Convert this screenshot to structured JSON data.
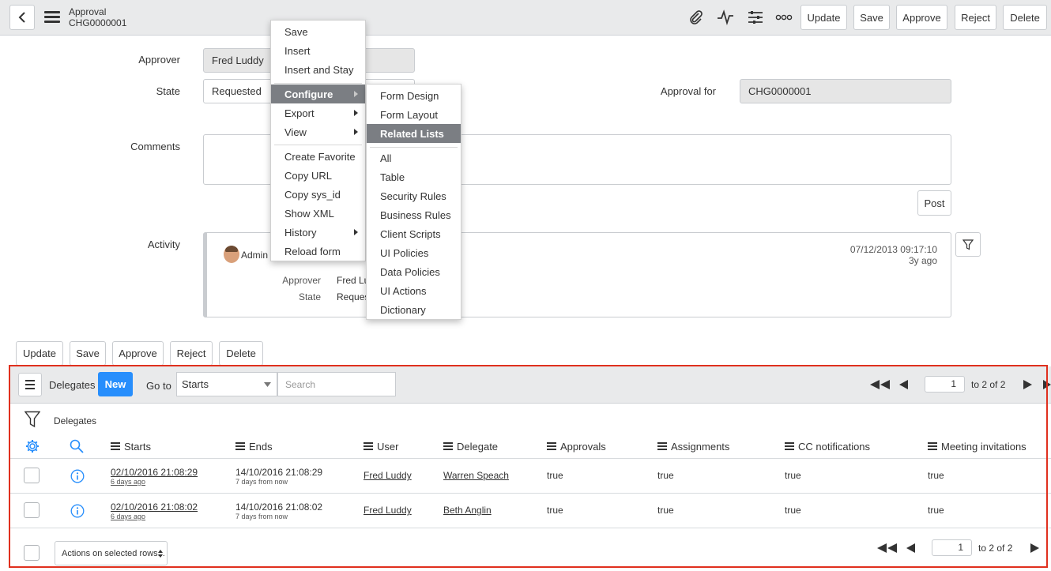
{
  "header": {
    "record_type": "Approval",
    "record_number": "CHG0000001",
    "buttons": [
      "Update",
      "Save",
      "Approve",
      "Reject",
      "Delete"
    ]
  },
  "form": {
    "approver_label": "Approver",
    "approver_value": "Fred Luddy",
    "state_label": "State",
    "state_value": "Requested",
    "approval_for_label": "Approval for",
    "approval_for_value": "CHG0000001",
    "comments_label": "Comments",
    "post_label": "Post",
    "activity_label": "Activity",
    "activity": {
      "user": "Admin",
      "timestamp": "07/12/2013 09:17:10",
      "relative": "3y ago",
      "f1_label": "Approver",
      "f1_value": "Fred Lu",
      "f2_label": "State",
      "f2_value": "Reques"
    }
  },
  "context_menu": {
    "items": [
      "Save",
      "Insert",
      "Insert and Stay",
      "Configure",
      "Export",
      "View",
      "Create Favorite",
      "Copy URL",
      "Copy sys_id",
      "Show XML",
      "History",
      "Reload form"
    ],
    "highlighted": "Configure"
  },
  "submenu": {
    "items": [
      "Form Design",
      "Form Layout",
      "Related Lists",
      "All",
      "Table",
      "Security Rules",
      "Business Rules",
      "Client Scripts",
      "UI Policies",
      "Data Policies",
      "UI Actions",
      "Dictionary"
    ],
    "highlighted": "Related Lists"
  },
  "bottom_buttons": [
    "Update",
    "Save",
    "Approve",
    "Reject",
    "Delete"
  ],
  "related_list": {
    "title": "Delegates",
    "new_label": "New",
    "goto_label": "Go to",
    "goto_field": "Starts",
    "search_placeholder": "Search",
    "page_value": "1",
    "page_text": "to 2 of 2",
    "breadcrumb": "Delegates",
    "columns": [
      "Starts",
      "Ends",
      "User",
      "Delegate",
      "Approvals",
      "Assignments",
      "CC notifications",
      "Meeting invitations"
    ],
    "rows": [
      {
        "starts": "02/10/2016 21:08:29",
        "starts_rel": "6 days ago",
        "ends": "14/10/2016 21:08:29",
        "ends_rel": "7 days from now",
        "user": "Fred Luddy",
        "delegate": "Warren Speach",
        "approvals": "true",
        "assignments": "true",
        "cc": "true",
        "meetings": "true"
      },
      {
        "starts": "02/10/2016 21:08:02",
        "starts_rel": "6 days ago",
        "ends": "14/10/2016 21:08:02",
        "ends_rel": "7 days from now",
        "user": "Fred Luddy",
        "delegate": "Beth Anglin",
        "approvals": "true",
        "assignments": "true",
        "cc": "true",
        "meetings": "true"
      }
    ],
    "actions_label": "Actions on selected rows...",
    "bottom_page_value": "1",
    "bottom_page_text": "to 2 of 2"
  },
  "colors": {
    "accent_blue": "#278efc",
    "highlight_outline": "#e0301e",
    "menu_highlight": "#7b7e83"
  }
}
